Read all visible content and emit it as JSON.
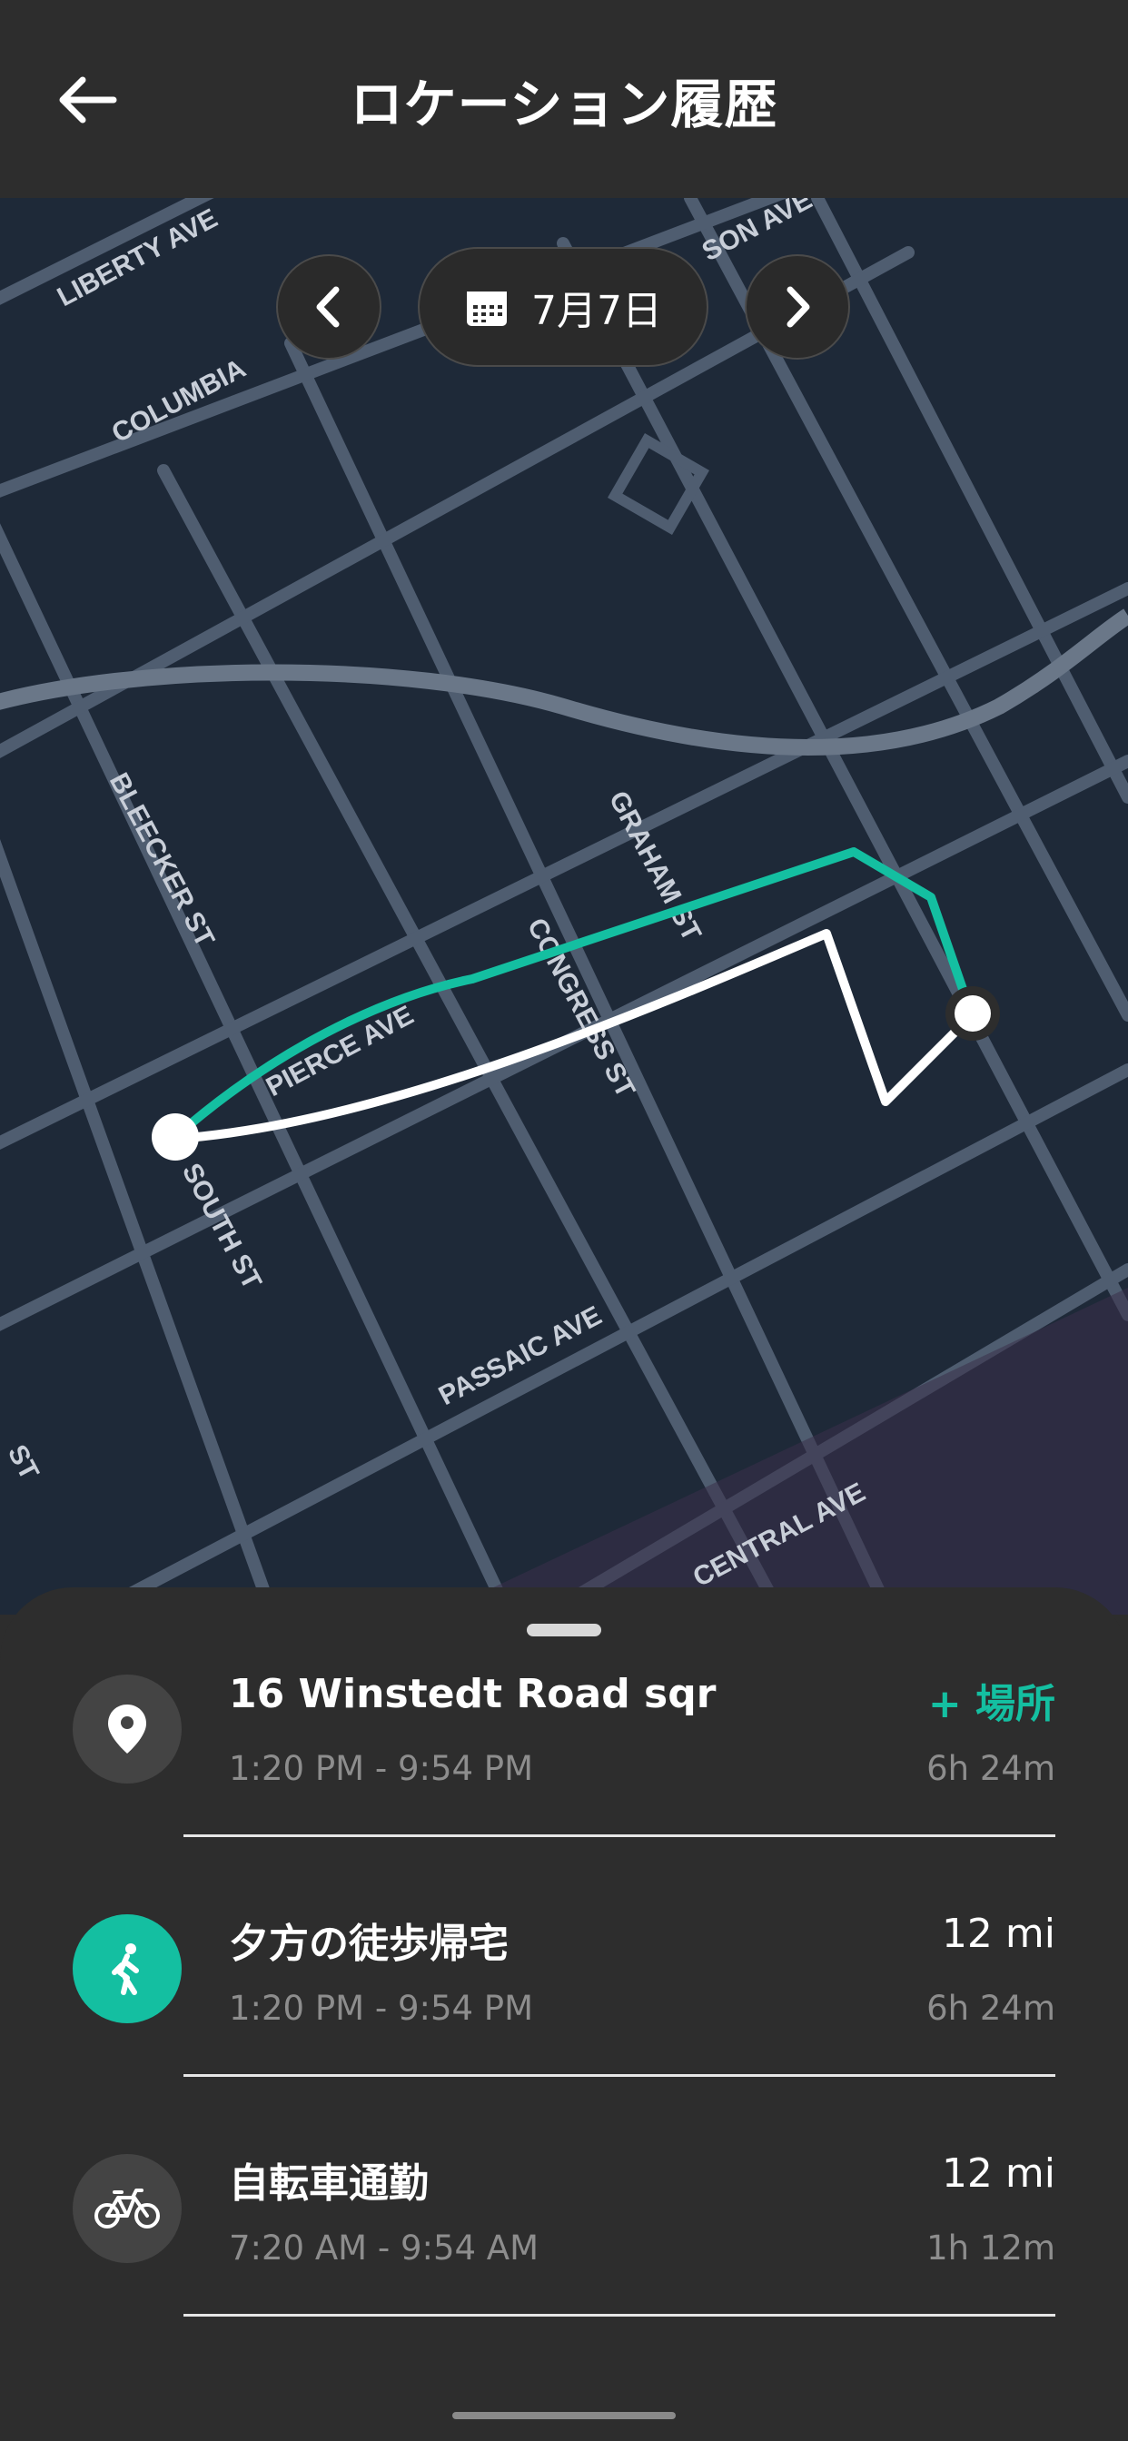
{
  "header": {
    "title": "ロケーション履歴",
    "back_icon": "arrow-left-icon"
  },
  "map": {
    "date_label": "7月7日",
    "prev_icon": "chevron-left-icon",
    "next_icon": "chevron-right-icon",
    "calendar_icon": "calendar-icon",
    "street_labels": [
      "LIBERTY AVE",
      "COLUMBIA",
      "SON AVE",
      "BLEECKER ST",
      "GRAHAM ST",
      "CONGRESS ST",
      "PIERCE AVE",
      "SOUTH ST",
      "PASSAIC AVE",
      "CENTRAL AVE",
      "ST"
    ],
    "colors": {
      "route_primary": "#14bfa1",
      "route_secondary": "#ffffff",
      "map_bg": "#1f2a3a",
      "road": "#56667a"
    }
  },
  "timeline": {
    "items": [
      {
        "icon": "location-pin-icon",
        "name": "16 Winstedt Road sqr",
        "time": "1:20 PM - 9:54 PM",
        "right_top": "+ 場所",
        "right_bottom": "6h 24m"
      },
      {
        "icon": "walking-icon",
        "name": "夕方の徒歩帰宅",
        "time": "1:20 PM - 9:54 PM",
        "right_top": "12 mi",
        "right_bottom": "6h 24m"
      },
      {
        "icon": "bicycle-icon",
        "name": "自転車通勤",
        "time": "7:20 AM - 9:54 AM",
        "right_top": "12 mi",
        "right_bottom": "1h 12m"
      }
    ]
  },
  "colors": {
    "accent": "#14bfa1",
    "background": "#2d2d2d"
  }
}
